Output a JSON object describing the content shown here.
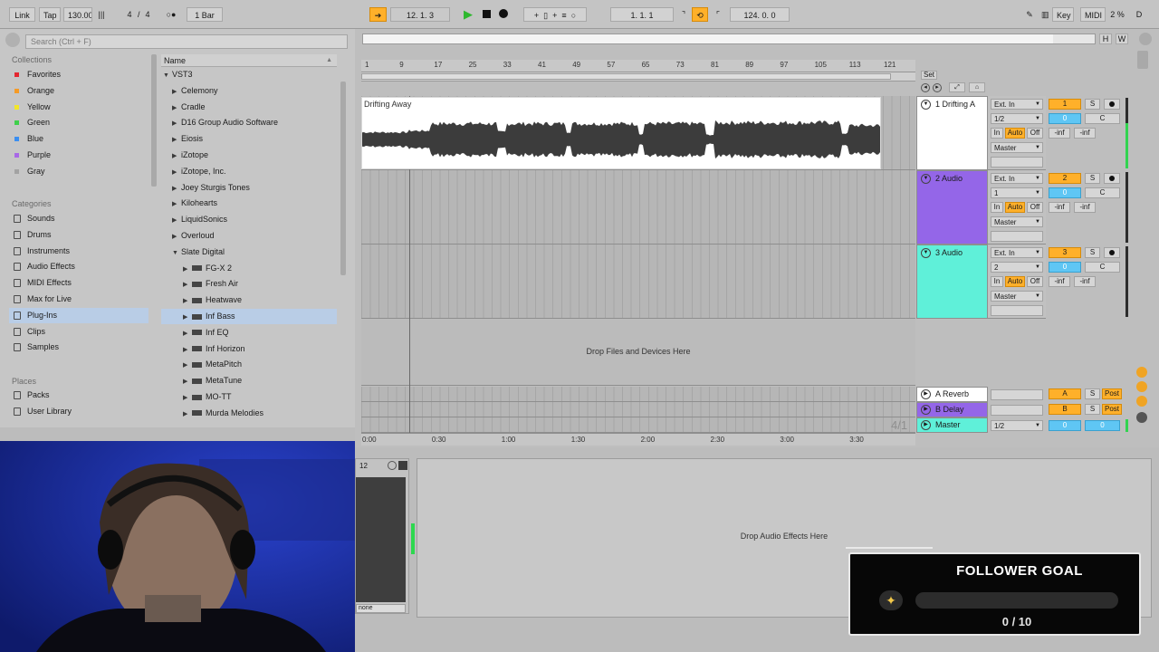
{
  "toolbar": {
    "link": "Link",
    "tap": "Tap",
    "tempo": "130.00",
    "metronome": "|||",
    "sig_num": "4",
    "sig_den": "4",
    "circle": "○●",
    "quant": "1 Bar",
    "position": "12.   1.   3",
    "loop_start": "1.   1.   1",
    "loop_len": "124.   0.   0",
    "key": "Key",
    "midi": "MIDI",
    "cpu": "2 %",
    "disk": "D"
  },
  "browser": {
    "search_placeholder": "Search (Ctrl + F)",
    "collections_title": "Collections",
    "collections": [
      {
        "label": "Favorites",
        "color": "#e3262f"
      },
      {
        "label": "Orange",
        "color": "#f59b26"
      },
      {
        "label": "Yellow",
        "color": "#f2e629"
      },
      {
        "label": "Green",
        "color": "#3fcf4b"
      },
      {
        "label": "Blue",
        "color": "#3a8ef0"
      },
      {
        "label": "Purple",
        "color": "#a868e6"
      },
      {
        "label": "Gray",
        "color": "#a2a2a2"
      }
    ],
    "categories_title": "Categories",
    "categories": [
      {
        "label": "Sounds",
        "icon": "sounds-icon"
      },
      {
        "label": "Drums",
        "icon": "drums-icon"
      },
      {
        "label": "Instruments",
        "icon": "instruments-icon"
      },
      {
        "label": "Audio Effects",
        "icon": "audio-effects-icon"
      },
      {
        "label": "MIDI Effects",
        "icon": "midi-effects-icon"
      },
      {
        "label": "Max for Live",
        "icon": "max-for-live-icon"
      },
      {
        "label": "Plug-Ins",
        "icon": "plug-ins-icon",
        "selected": true
      },
      {
        "label": "Clips",
        "icon": "clips-icon"
      },
      {
        "label": "Samples",
        "icon": "samples-icon"
      }
    ],
    "places_title": "Places",
    "places": [
      {
        "label": "Packs",
        "icon": "packs-icon"
      },
      {
        "label": "User Library",
        "icon": "user-library-icon"
      }
    ],
    "name_header": "Name",
    "root": "VST3",
    "folders": [
      "Celemony",
      "Cradle",
      "D16 Group Audio Software",
      "Eiosis",
      "iZotope",
      "iZotope, Inc.",
      "Joey Sturgis Tones",
      "Kilohearts",
      "LiquidSonics",
      "Overloud"
    ],
    "open_folder": "Slate Digital",
    "plugins": [
      "FG-X 2",
      "Fresh Air",
      "Heatwave",
      "Inf Bass",
      "Inf EQ",
      "Inf Horizon",
      "MetaPitch",
      "MetaTune",
      "MO-TT",
      "Murda Melodies"
    ],
    "selected_plugin": "Inf Bass"
  },
  "arrangement": {
    "bar_ticks": [
      "1",
      "9",
      "17",
      "25",
      "33",
      "41",
      "49",
      "57",
      "65",
      "73",
      "81",
      "89",
      "97",
      "105",
      "113",
      "121"
    ],
    "time_ticks": [
      "0:00",
      "0:30",
      "1:00",
      "1:30",
      "2:00",
      "2:30",
      "3:00",
      "3:30"
    ],
    "clip_name": "Drifting Away",
    "drop_text": "Drop Files and Devices Here",
    "time_sig": "4/1",
    "set_label": "Set",
    "overview_h": "H",
    "overview_w": "W"
  },
  "tracks": [
    {
      "name": "1 Drifting A",
      "input": "Ext. In",
      "channel": "1/2",
      "output": "Master",
      "number": "1",
      "solo": "S",
      "volume": "0",
      "pan": "C",
      "mon_in": "In",
      "mon_auto": "Auto",
      "mon_off": "Off",
      "peak1": "-inf",
      "peak2": "-inf",
      "color": "#ffffff"
    },
    {
      "name": "2 Audio",
      "input": "Ext. In",
      "channel": "1",
      "output": "Master",
      "number": "2",
      "solo": "S",
      "volume": "0",
      "pan": "C",
      "mon_in": "In",
      "mon_auto": "Auto",
      "mon_off": "Off",
      "peak1": "-inf",
      "peak2": "-inf",
      "color": "#9466e8"
    },
    {
      "name": "3 Audio",
      "input": "Ext. In",
      "channel": "2",
      "output": "Master",
      "number": "3",
      "solo": "S",
      "volume": "0",
      "pan": "C",
      "mon_in": "In",
      "mon_auto": "Auto",
      "mon_off": "Off",
      "peak1": "-inf",
      "peak2": "-inf",
      "color": "#5ff0d9"
    }
  ],
  "returns": [
    {
      "name": "A Reverb",
      "letter": "A",
      "solo": "S",
      "post": "Post",
      "color": "#ffffff"
    },
    {
      "name": "B Delay",
      "letter": "B",
      "solo": "S",
      "post": "Post",
      "color": "#9466e8"
    }
  ],
  "master": {
    "name": "Master",
    "channel": "1/2",
    "volume": "0",
    "pan": "0",
    "color": "#5ff0d9"
  },
  "device": {
    "drop_text": "Drop Audio Effects Here",
    "small_panel_title": "12",
    "small_panel_value": "none"
  },
  "goal": {
    "title": "FOLLOWER GOAL",
    "count": "0 / 10",
    "progress": 0,
    "icon": "sparkle-icon"
  }
}
